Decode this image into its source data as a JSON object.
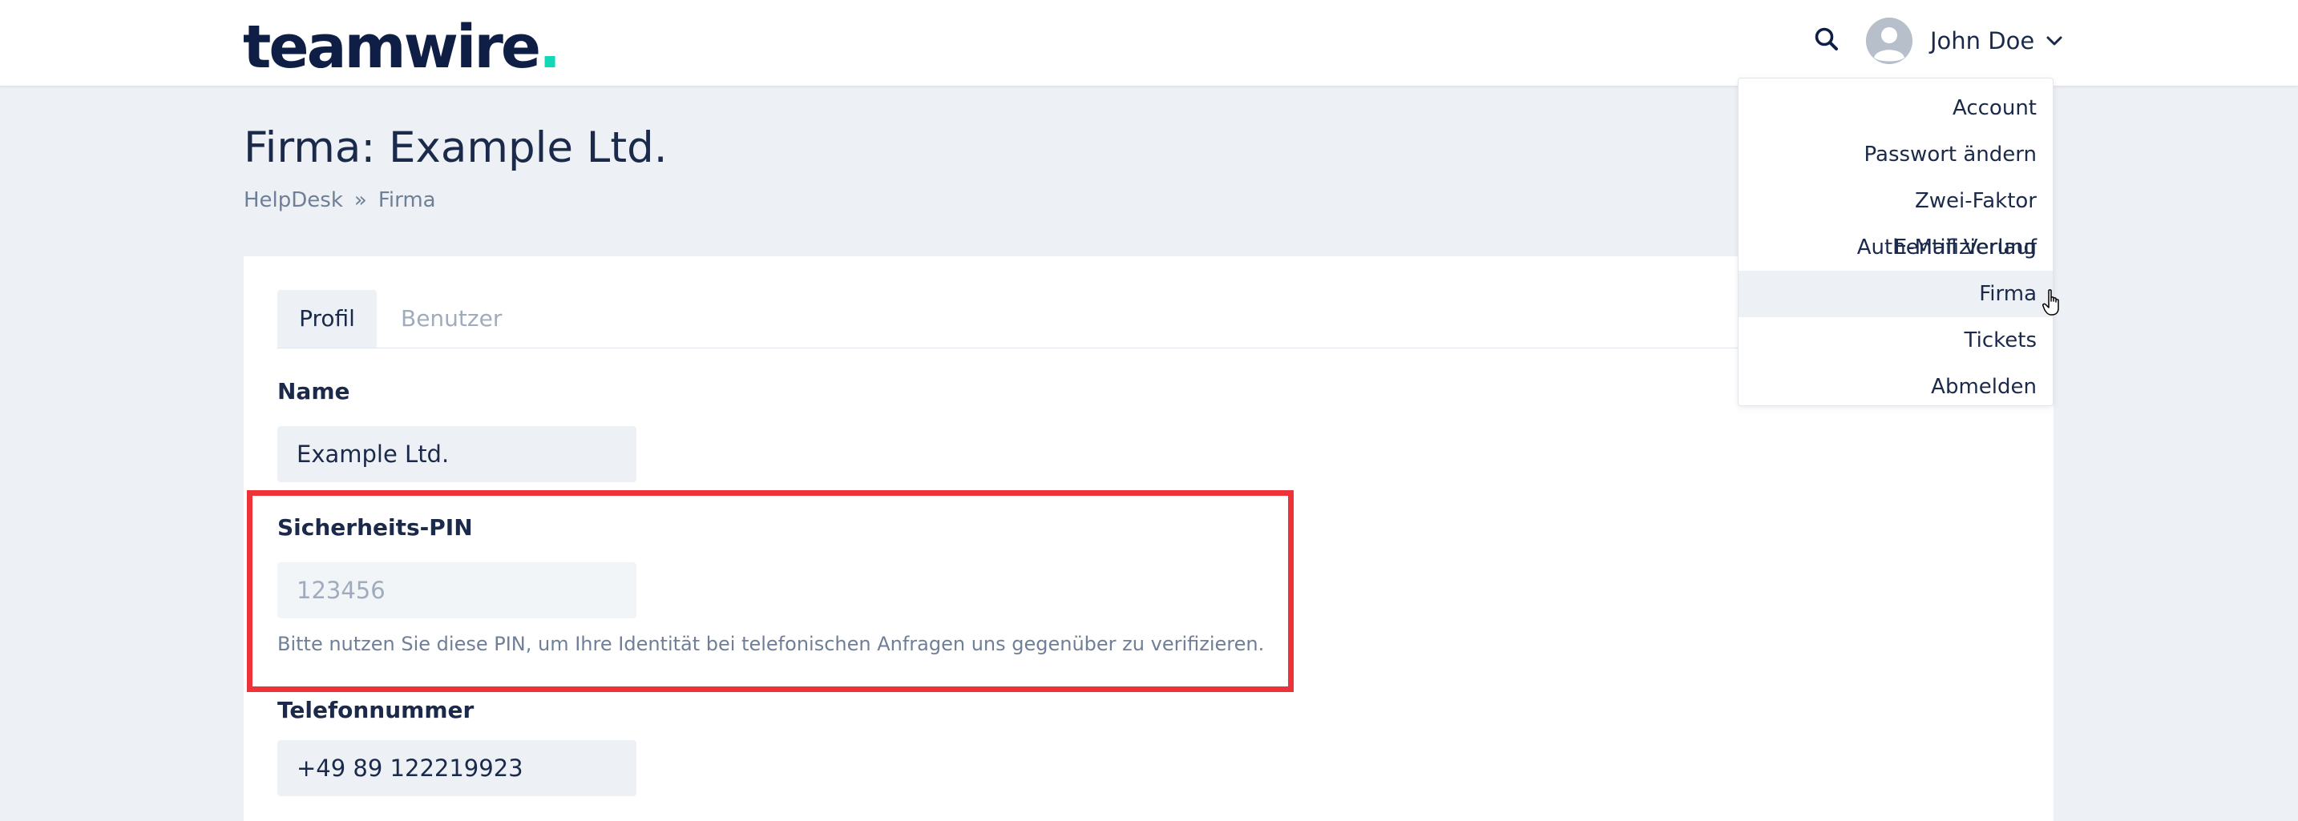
{
  "header": {
    "logo_text": "teamwire",
    "logo_dot": ".",
    "user_name": "John Doe"
  },
  "page": {
    "title": "Firma: Example Ltd.",
    "breadcrumb": [
      "HelpDesk",
      "»",
      "Firma"
    ]
  },
  "tabs": [
    {
      "label": "Profil",
      "active": true
    },
    {
      "label": "Benutzer",
      "active": false
    }
  ],
  "form": {
    "name_label": "Name",
    "name_value": "Example Ltd.",
    "pin_label": "Sicherheits-PIN",
    "pin_value": "123456",
    "pin_help": "Bitte nutzen Sie diese PIN, um Ihre Identität bei telefonischen Anfragen uns gegenüber zu verifizieren.",
    "phone_label": "Telefonnummer",
    "phone_value": "+49 89 122219923"
  },
  "user_menu": {
    "items": [
      {
        "label": "Account"
      },
      {
        "label": "Passwort ändern"
      },
      {
        "label": "Zwei-Faktor Authentifizierung"
      },
      {
        "label": "E-Mail Verlauf"
      },
      {
        "label": "Firma",
        "hovered": true
      },
      {
        "label": "Tickets"
      },
      {
        "label": "Abmelden"
      }
    ]
  },
  "colors": {
    "accent": "#12d8b8",
    "brand_dark": "#0f1e45",
    "highlight": "#ee3338",
    "page_bg": "#edf1f5"
  },
  "icons": [
    "search-icon",
    "user-avatar-icon",
    "chevron-down-icon",
    "hand-cursor-icon"
  ]
}
